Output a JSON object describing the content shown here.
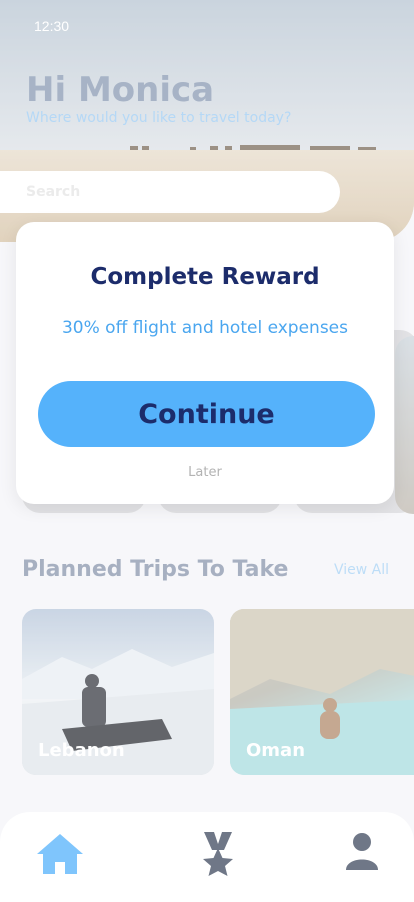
{
  "status_bar": {
    "time": "12:30"
  },
  "header": {
    "greeting": "Hi Monica",
    "subtitle": "Where would you like to travel today?"
  },
  "search": {
    "placeholder": "Search"
  },
  "planned_trips": {
    "title": "Planned Trips To Take",
    "view_all": "View All",
    "cards": [
      {
        "label": "Lebanon"
      },
      {
        "label": "Oman"
      }
    ]
  },
  "bottom_nav": {
    "items": [
      {
        "icon": "home-icon",
        "active": true
      },
      {
        "icon": "medal-icon",
        "active": false
      },
      {
        "icon": "profile-icon",
        "active": false
      }
    ]
  },
  "modal": {
    "title": "Complete Reward",
    "subtitle": "30% off flight and hotel expenses",
    "continue_label": "Continue",
    "later_label": "Later"
  },
  "colors": {
    "primary": "#55b2fb",
    "navy": "#1c2c6b",
    "accent_text": "#4aa6ef"
  }
}
